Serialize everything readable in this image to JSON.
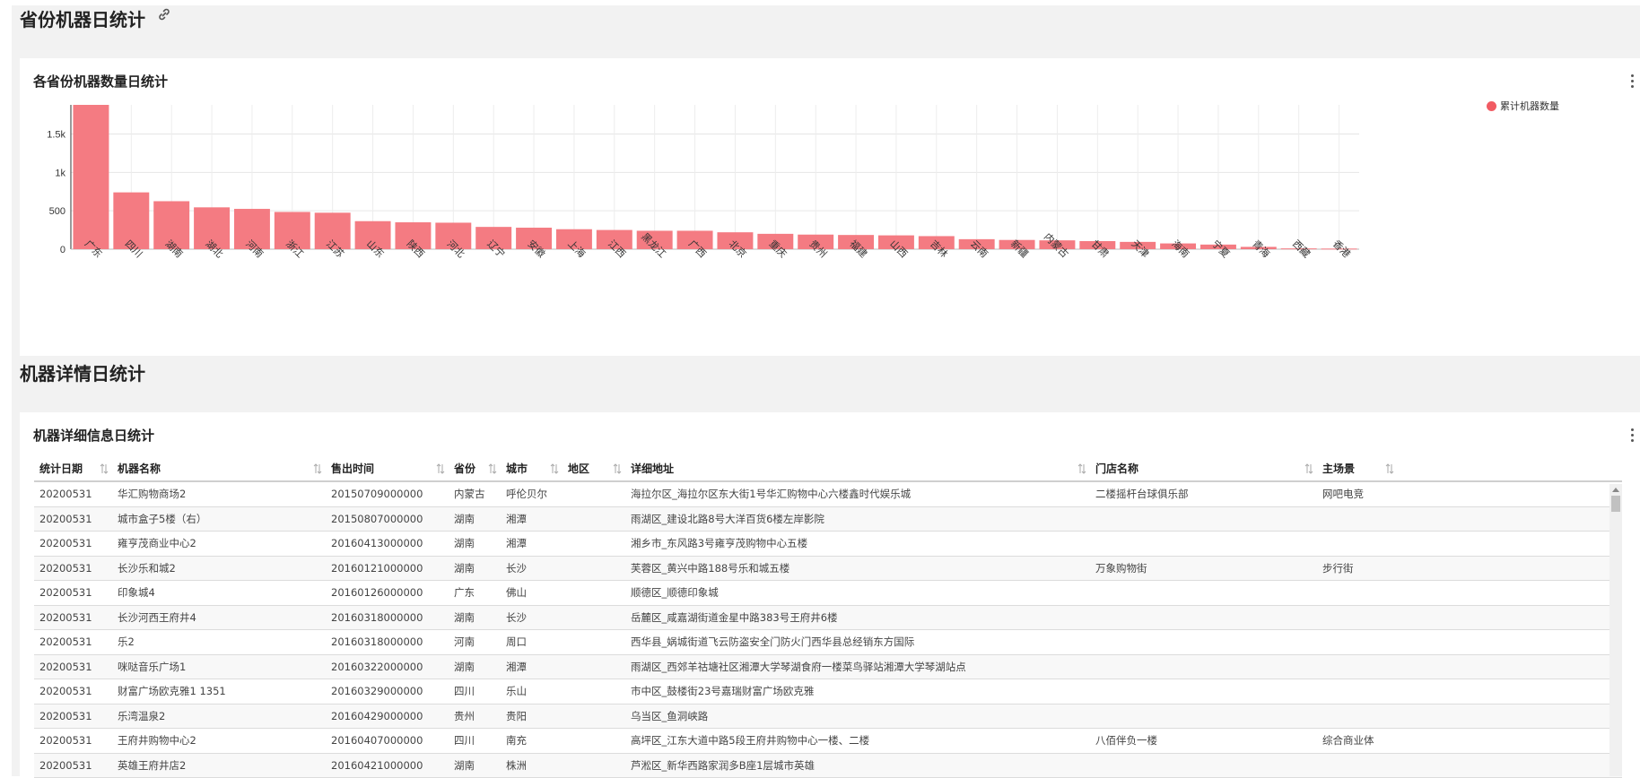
{
  "section1": {
    "title": "省份机器日统计"
  },
  "chart_card": {
    "title": "各省份机器数量日统计"
  },
  "section2": {
    "title": "机器详情日统计"
  },
  "table_card": {
    "title": "机器详细信息日统计"
  },
  "colors": {
    "bar": "#f47b82",
    "legend": "#f15b63"
  },
  "chart_data": {
    "type": "bar",
    "categories": [
      "广东",
      "四川",
      "湖南",
      "湖北",
      "河南",
      "浙江",
      "江苏",
      "山东",
      "陕西",
      "河北",
      "辽宁",
      "安徽",
      "上海",
      "江西",
      "黑龙江",
      "广西",
      "北京",
      "重庆",
      "贵州",
      "福建",
      "山西",
      "吉林",
      "云南",
      "新疆",
      "内蒙古",
      "甘肃",
      "天津",
      "海南",
      "宁夏",
      "青海",
      "西藏",
      "香港"
    ],
    "series": [
      {
        "name": "累计机器数量",
        "values": [
          1880,
          740,
          625,
          545,
          525,
          485,
          475,
          365,
          350,
          345,
          290,
          280,
          260,
          250,
          240,
          240,
          220,
          200,
          190,
          185,
          180,
          170,
          130,
          120,
          115,
          105,
          95,
          75,
          60,
          30,
          10,
          8
        ]
      }
    ],
    "yticks": [
      "0",
      "500",
      "1k",
      "1.5k"
    ],
    "ylim": [
      0,
      1880
    ],
    "grid": true,
    "legend_position": "top-right"
  },
  "table": {
    "columns": [
      "统计日期",
      "机器名称",
      "售出时间",
      "省份",
      "城市",
      "地区",
      "详细地址",
      "门店名称",
      "主场景"
    ],
    "rows": [
      [
        "20200531",
        "华汇购物商场2",
        "20150709000000",
        "内蒙古",
        "呼伦贝尔",
        "",
        "海拉尔区_海拉尔区东大街1号华汇购物中心六楼鑫时代娱乐城",
        "二楼摇杆台球俱乐部",
        "网吧电竞"
      ],
      [
        "20200531",
        "城市盒子5楼（右）",
        "20150807000000",
        "湖南",
        "湘潭",
        "",
        "雨湖区_建设北路8号大洋百货6楼左岸影院",
        "",
        ""
      ],
      [
        "20200531",
        "雍亨茂商业中心2",
        "20160413000000",
        "湖南",
        "湘潭",
        "",
        "湘乡市_东风路3号雍亨茂购物中心五楼",
        "",
        ""
      ],
      [
        "20200531",
        "长沙乐和城2",
        "20160121000000",
        "湖南",
        "长沙",
        "",
        "芙蓉区_黄兴中路188号乐和城五楼",
        "万象购物街",
        "步行街"
      ],
      [
        "20200531",
        "印象城4",
        "20160126000000",
        "广东",
        "佛山",
        "",
        "顺德区_顺德印象城",
        "",
        ""
      ],
      [
        "20200531",
        "长沙河西王府井4",
        "20160318000000",
        "湖南",
        "长沙",
        "",
        "岳麓区_咸嘉湖街道金星中路383号王府井6楼",
        "",
        ""
      ],
      [
        "20200531",
        "乐2",
        "20160318000000",
        "河南",
        "周口",
        "",
        "西华县_娲城街道飞云防盗安全门防火门西华县总经销东方国际",
        "",
        ""
      ],
      [
        "20200531",
        "咪哒音乐广场1",
        "20160322000000",
        "湖南",
        "湘潭",
        "",
        "雨湖区_西郊羊祜塘社区湘潭大学琴湖食府一楼菜鸟驿站湘潭大学琴湖站点",
        "",
        ""
      ],
      [
        "20200531",
        "财富广场欧克雅1 1351",
        "20160329000000",
        "四川",
        "乐山",
        "",
        "市中区_鼓楼街23号嘉瑞财富广场欧克雅",
        "",
        ""
      ],
      [
        "20200531",
        "乐湾温泉2",
        "20160429000000",
        "贵州",
        "贵阳",
        "",
        "乌当区_鱼洞峡路",
        "",
        ""
      ],
      [
        "20200531",
        "王府井购物中心2",
        "20160407000000",
        "四川",
        "南充",
        "",
        "高坪区_江东大道中路5段王府井购物中心一楼、二楼",
        "八佰伴负一楼",
        "综合商业体"
      ],
      [
        "20200531",
        "英雄王府井店2",
        "20160421000000",
        "湖南",
        "株洲",
        "",
        "芦淞区_新华西路家润多B座1层城市英雄",
        "",
        ""
      ]
    ]
  }
}
